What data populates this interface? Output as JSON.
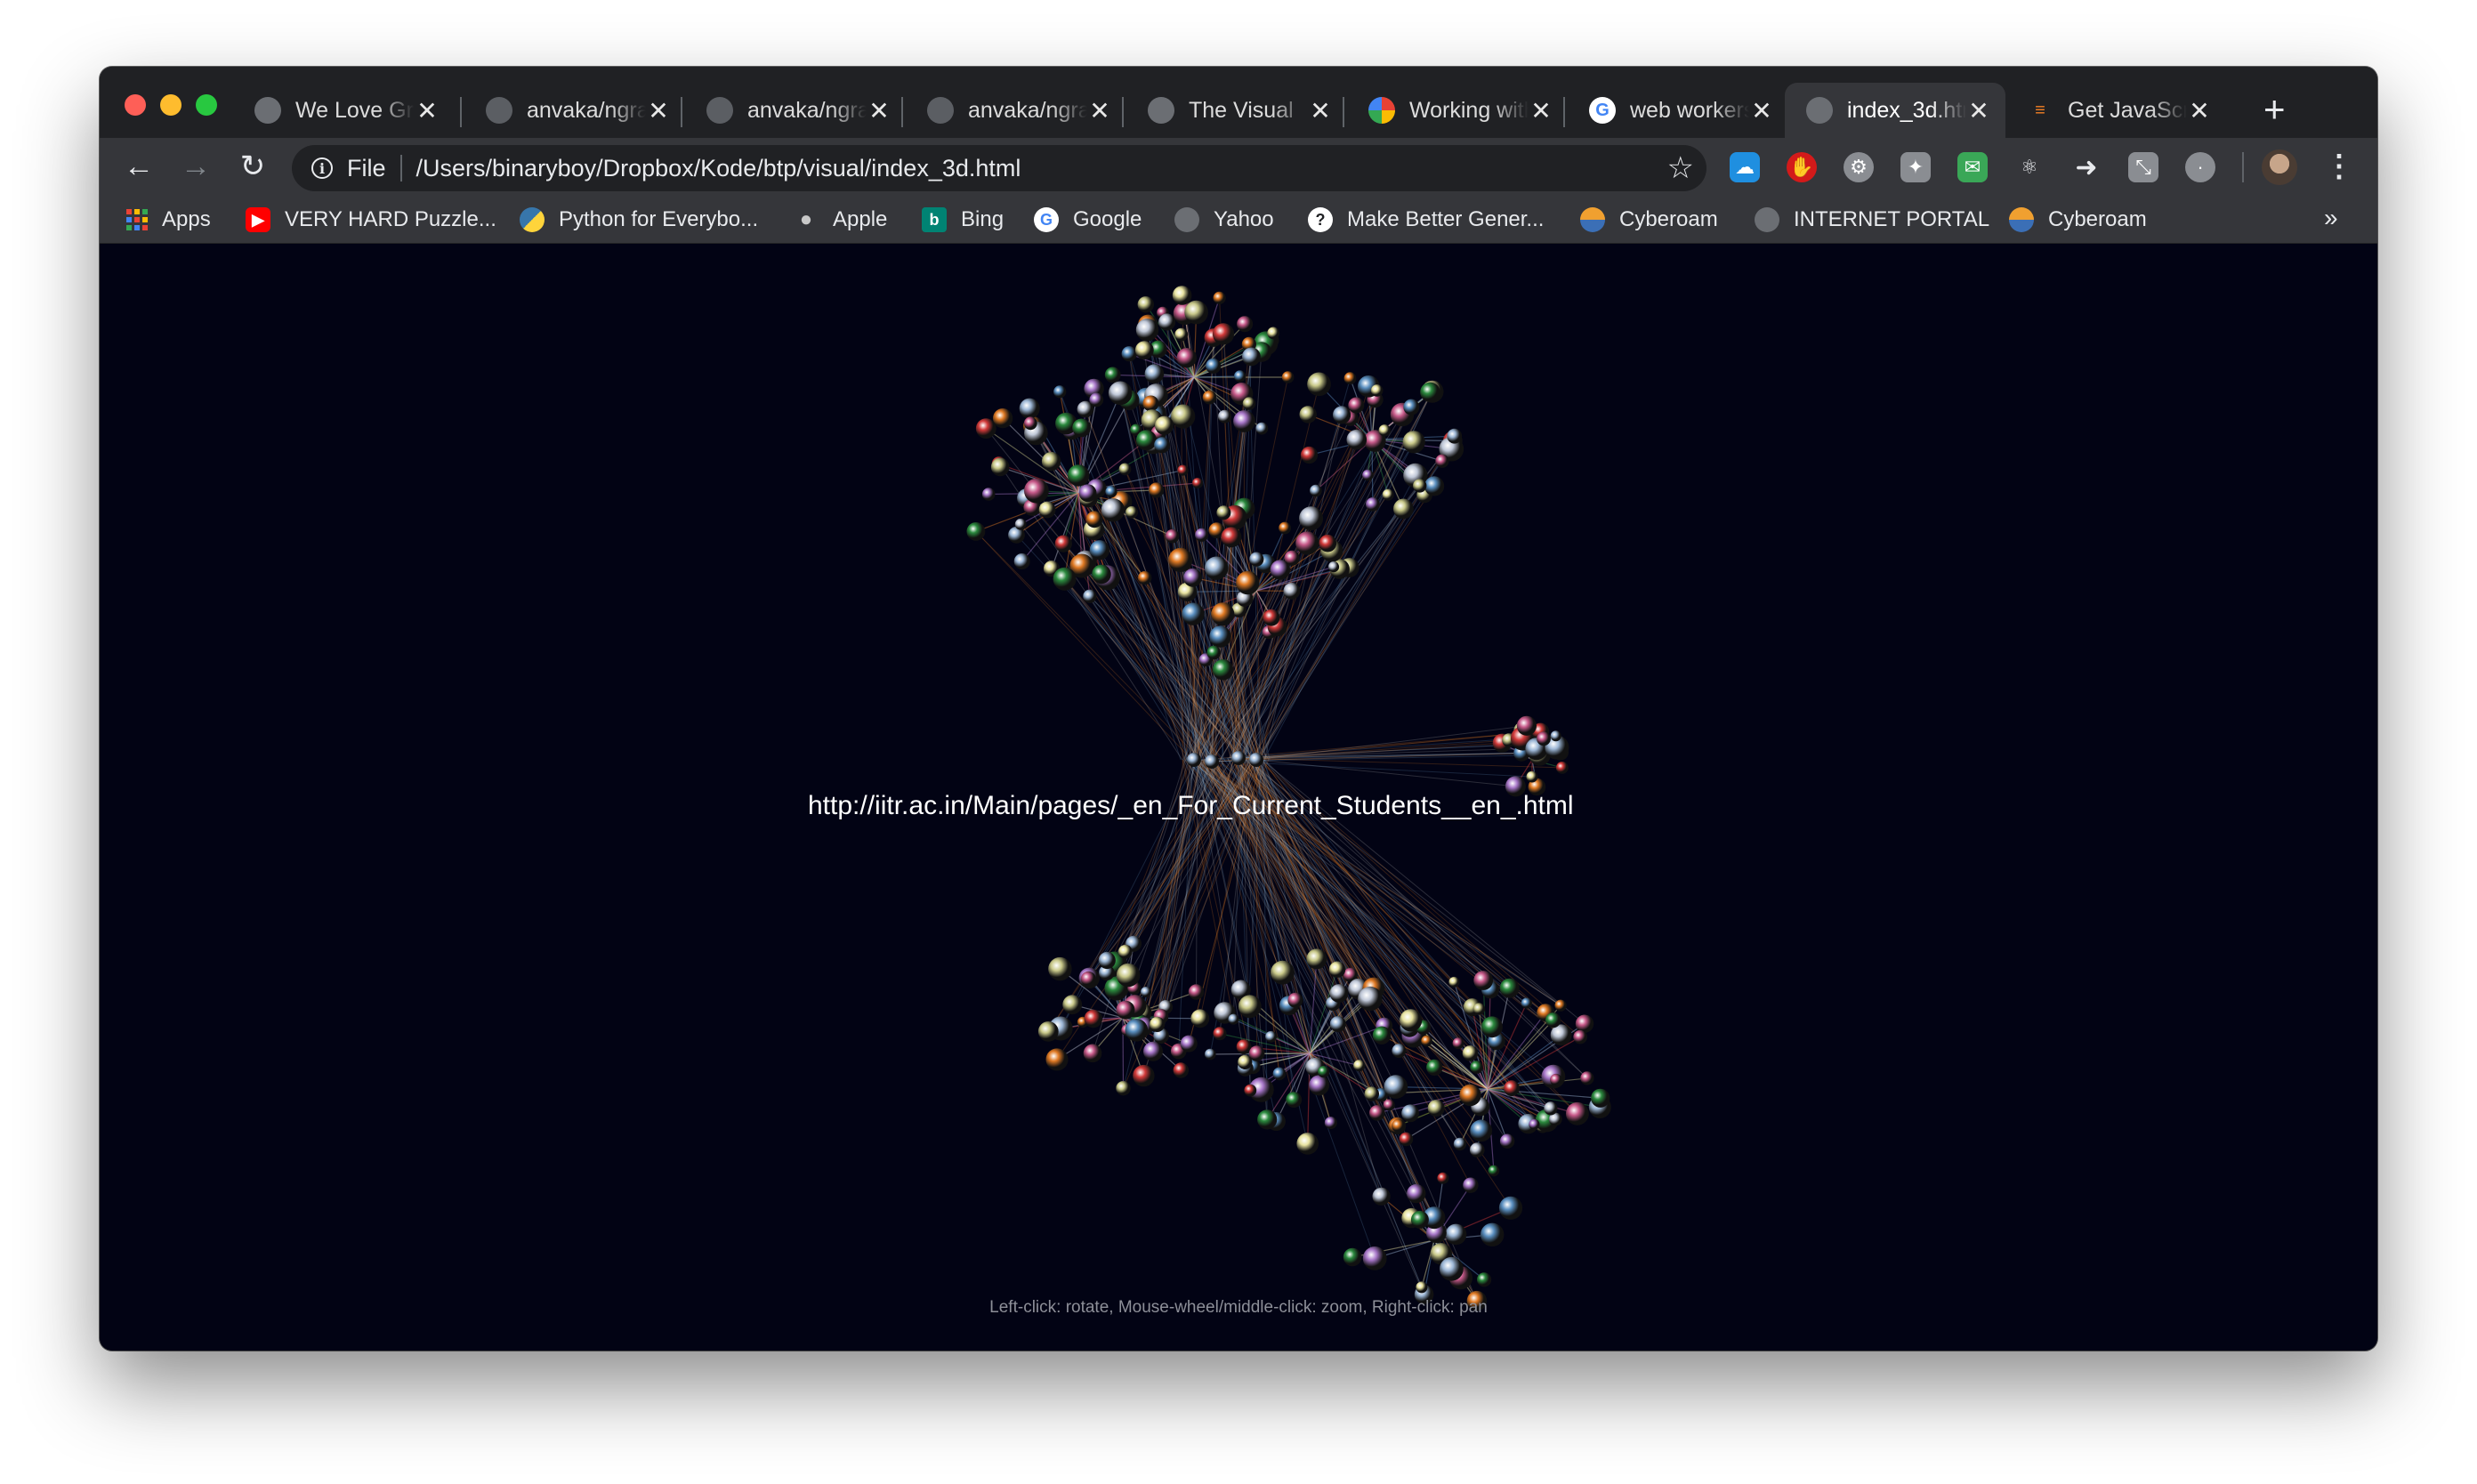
{
  "browser": {
    "tabs": [
      {
        "title": "We Love Graphs",
        "favicon": "globe",
        "active": false
      },
      {
        "title": "anvaka/ngraph",
        "favicon": "github",
        "active": false
      },
      {
        "title": "anvaka/ngraph",
        "favicon": "github",
        "active": false
      },
      {
        "title": "anvaka/ngraph",
        "favicon": "github",
        "active": false
      },
      {
        "title": "The Visual",
        "favicon": "globe",
        "active": false
      },
      {
        "title": "Working with",
        "favicon": "pinwheel",
        "active": false
      },
      {
        "title": "web workers",
        "favicon": "google",
        "active": false
      },
      {
        "title": "index_3d.html",
        "favicon": "globe",
        "active": true
      },
      {
        "title": "Get JavaScript",
        "favicon": "stackoverflow",
        "active": false
      }
    ],
    "close_glyph": "✕",
    "new_tab_glyph": "+",
    "nav": {
      "back": "←",
      "forward": "→",
      "reload": "↻"
    },
    "address": {
      "scheme": "File",
      "url": "/Users/binaryboy/Dropbox/Kode/btp/visual/index_3d.html"
    },
    "bookmarks": [
      {
        "label": "Apps",
        "icon": "apps-grid"
      },
      {
        "label": "VERY HARD Puzzle...",
        "icon": "youtube"
      },
      {
        "label": "Python for Everybo...",
        "icon": "python"
      },
      {
        "label": "Apple",
        "icon": "apple"
      },
      {
        "label": "Bing",
        "icon": "bing"
      },
      {
        "label": "Google",
        "icon": "google"
      },
      {
        "label": "Yahoo",
        "icon": "globe"
      },
      {
        "label": "Make Better Gener...",
        "icon": "generic"
      },
      {
        "label": "Cyberoam",
        "icon": "cyberoam"
      },
      {
        "label": "INTERNET PORTAL",
        "icon": "globe"
      },
      {
        "label": "Cyberoam",
        "icon": "cyberoam"
      }
    ],
    "bookmarks_overflow": "»"
  },
  "page": {
    "hovered_node_label": "http://iitr.ac.in/Main/pages/_en_For_Current_Students__en_.html",
    "controls_hint": "Left-click: rotate, Mouse-wheel/middle-click: zoom, Right-click: pan",
    "background_color": "#020314",
    "node_colors": [
      "#c0c8d8",
      "#e07a24",
      "#c9c98a",
      "#d23a3a",
      "#2b8a3e",
      "#5a8fc0",
      "#a877c9",
      "#9db7d6",
      "#e8e3a0",
      "#c75a8a"
    ]
  }
}
